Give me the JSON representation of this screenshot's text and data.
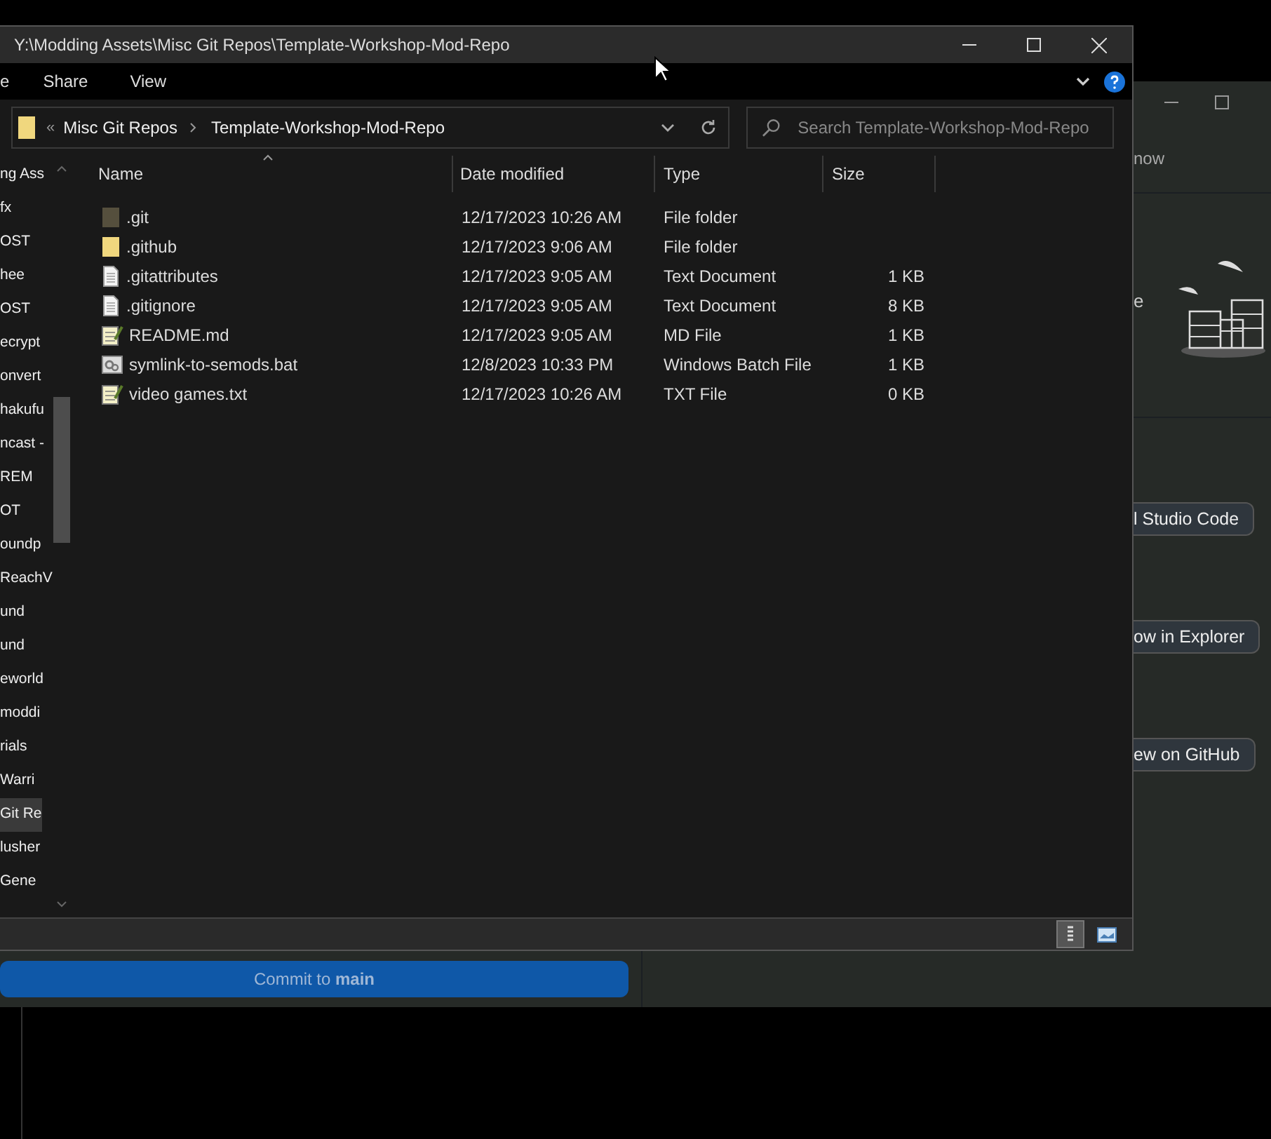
{
  "background_window": {
    "right_panel": {
      "header_text": "now",
      "body_text": "e",
      "buttons": [
        "l Studio Code",
        "ow in Explorer",
        "ew on GitHub"
      ]
    },
    "commit_button": "Commit to **main**"
  },
  "explorer": {
    "title": "Y:\\Modding Assets\\Misc Git Repos\\Template-Workshop-Mod-Repo",
    "ribbon_tabs": [
      "e",
      "Share",
      "View"
    ],
    "overflow_mark": "«",
    "breadcrumb": [
      "Misc Git Repos",
      "Template-Workshop-Mod-Repo"
    ],
    "search": {
      "placeholder": "Search Template-Workshop-Mod-Repo"
    },
    "nav_items": [
      {
        "label": "ng Ass",
        "selected": false
      },
      {
        "label": "fx",
        "selected": false
      },
      {
        "label": "OST",
        "selected": false
      },
      {
        "label": "hee",
        "selected": false
      },
      {
        "label": "OST",
        "selected": false
      },
      {
        "label": "ecrypt",
        "selected": false
      },
      {
        "label": "onvert",
        "selected": false
      },
      {
        "label": "hakufu",
        "selected": false
      },
      {
        "label": "ncast -",
        "selected": false
      },
      {
        "label": "REM",
        "selected": false
      },
      {
        "label": "OT",
        "selected": false
      },
      {
        "label": "oundp",
        "selected": false
      },
      {
        "label": "ReachV",
        "selected": false
      },
      {
        "label": "und",
        "selected": false
      },
      {
        "label": "und",
        "selected": false
      },
      {
        "label": "eworld",
        "selected": false
      },
      {
        "label": "moddi",
        "selected": false
      },
      {
        "label": "rials",
        "selected": false
      },
      {
        "label": "Warri",
        "selected": false
      },
      {
        "label": "Git Re",
        "selected": true
      },
      {
        "label": "lusher",
        "selected": false
      },
      {
        "label": "Gene",
        "selected": false
      }
    ],
    "columns": [
      "Name",
      "Date modified",
      "Type",
      "Size"
    ],
    "files": [
      {
        "kind": "folder",
        "hidden": true,
        "name": ".git",
        "date": "12/17/2023 10:26 AM",
        "type": "File folder"
      },
      {
        "kind": "folder",
        "hidden": false,
        "name": ".github",
        "date": "12/17/2023 9:06 AM",
        "type": "File folder"
      },
      {
        "kind": "text",
        "hidden": false,
        "name": ".gitattributes",
        "date": "12/17/2023 9:05 AM",
        "type": "Text Document",
        "size": "1 KB"
      },
      {
        "kind": "text",
        "hidden": false,
        "name": ".gitignore",
        "date": "12/17/2023 9:05 AM",
        "type": "Text Document",
        "size": "8 KB"
      },
      {
        "kind": "notepad",
        "hidden": false,
        "name": "README.md",
        "date": "12/17/2023 9:05 AM",
        "type": "MD File",
        "size": "1 KB"
      },
      {
        "kind": "batch",
        "hidden": false,
        "name": "symlink-to-semods.bat",
        "date": "12/8/2023 10:33 PM",
        "type": "Windows Batch File",
        "size": "1 KB"
      },
      {
        "kind": "notepad",
        "hidden": false,
        "name": "video games.txt",
        "date": "12/17/2023 10:26 AM",
        "type": "TXT File",
        "size": "0 KB"
      }
    ],
    "view_modes": [
      {
        "kind": "details",
        "selected": true
      },
      {
        "kind": "large_icons",
        "selected": false
      }
    ]
  }
}
